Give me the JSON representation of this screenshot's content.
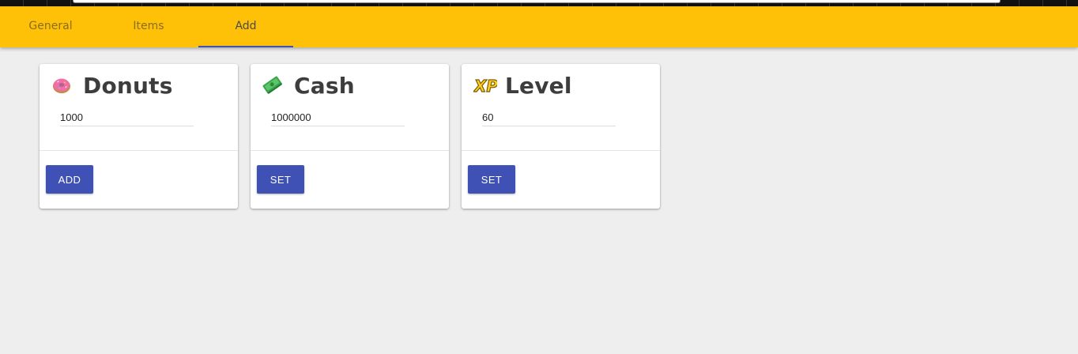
{
  "tabs": [
    {
      "label": "General",
      "active": false
    },
    {
      "label": "Items",
      "active": false
    },
    {
      "label": "Add",
      "active": true
    }
  ],
  "colors": {
    "appbar": "#ffc107",
    "tab_indicator": "#3f51b5",
    "button": "#3f51b5",
    "background": "#eeeeee"
  },
  "cards": [
    {
      "title": "Donuts",
      "icon": "donut-icon",
      "value": "1000",
      "button_label": "ADD"
    },
    {
      "title": "Cash",
      "icon": "cash-icon",
      "value": "1000000",
      "button_label": "SET"
    },
    {
      "title": "Level",
      "icon": "xp-icon",
      "icon_text": "XP",
      "value": "60",
      "button_label": "SET"
    }
  ]
}
